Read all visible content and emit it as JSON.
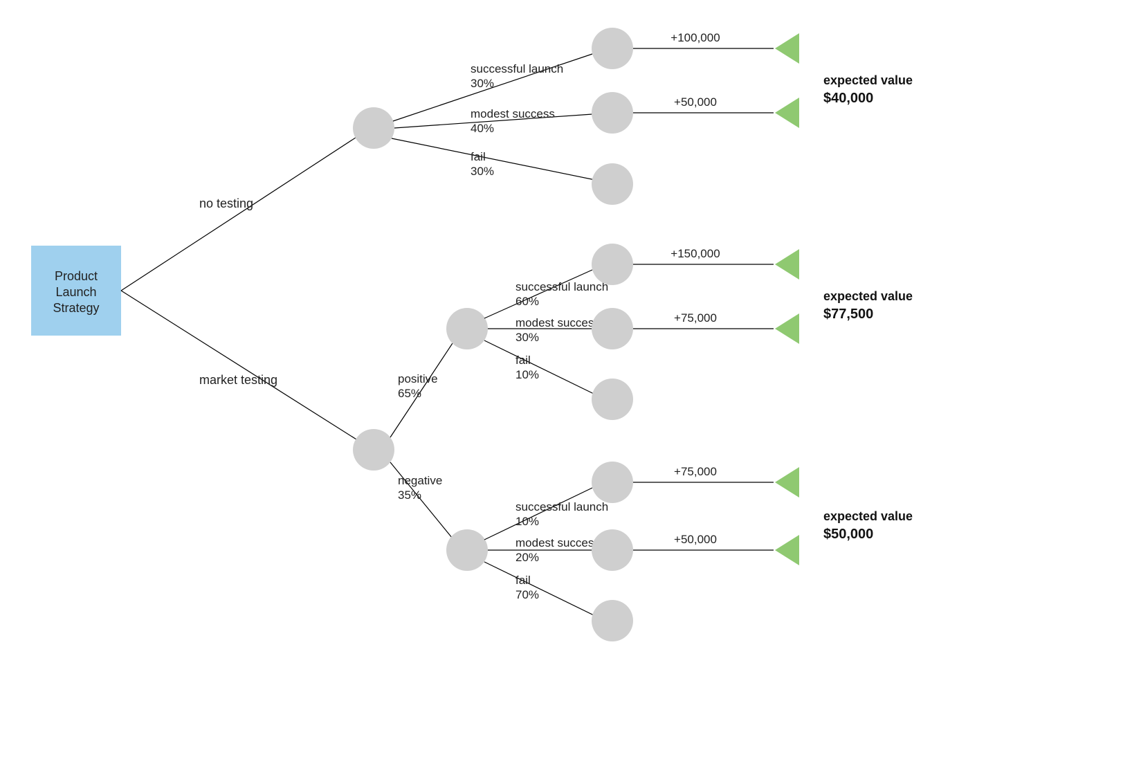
{
  "root": {
    "line1": "Product",
    "line2": "Launch",
    "line3": "Strategy"
  },
  "branches": {
    "no_testing": {
      "label": "no testing",
      "outcomes": {
        "success": {
          "label": "successful launch",
          "prob": "30%",
          "value": "+100,000"
        },
        "modest": {
          "label": "modest success",
          "prob": "40%",
          "value": "+50,000"
        },
        "fail": {
          "label": "fail",
          "prob": "30%"
        }
      },
      "expected": {
        "title": "expected value",
        "amount": "$40,000"
      }
    },
    "market_testing": {
      "label": "market testing",
      "positive": {
        "label": "positive",
        "prob": "65%",
        "outcomes": {
          "success": {
            "label": "successful launch",
            "prob": "60%",
            "value": "+150,000"
          },
          "modest": {
            "label": "modest success",
            "prob": "30%",
            "value": "+75,000"
          },
          "fail": {
            "label": "fail",
            "prob": "10%"
          }
        },
        "expected": {
          "title": "expected value",
          "amount": "$77,500"
        }
      },
      "negative": {
        "label": "negative",
        "prob": "35%",
        "outcomes": {
          "success": {
            "label": "successful launch",
            "prob": "10%",
            "value": "+75,000"
          },
          "modest": {
            "label": "modest success",
            "prob": "20%",
            "value": "+50,000"
          },
          "fail": {
            "label": "fail",
            "prob": "70%"
          }
        },
        "expected": {
          "title": "expected value",
          "amount": "$50,000"
        }
      }
    }
  }
}
